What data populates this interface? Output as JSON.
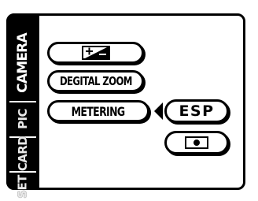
{
  "sidebar": {
    "tabs": [
      {
        "label": "CAMERA",
        "active": true
      },
      {
        "label": "PIC",
        "active": false
      },
      {
        "label": "CARD",
        "active": false
      },
      {
        "label": "SET",
        "active": false
      }
    ]
  },
  "menu": {
    "items": [
      {
        "label": "",
        "icon": "exposure-compensation-icon"
      },
      {
        "label": "DEGITAL ZOOM"
      },
      {
        "label": "METERING",
        "selected": true
      }
    ]
  },
  "submenu": {
    "options": [
      {
        "label": "ESP",
        "selected": true
      },
      {
        "label": "",
        "icon": "spot-metering-icon"
      }
    ]
  },
  "colors": {
    "foreground": "#000000",
    "background": "#ffffff"
  }
}
